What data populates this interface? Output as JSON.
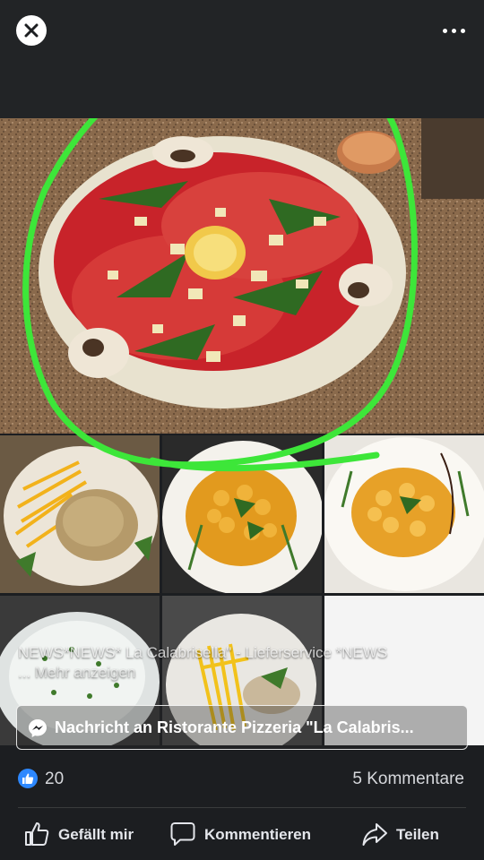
{
  "post": {
    "caption_text": "NEWS*NEWS* La Calabrisella\" - Lieferservice *NEWS",
    "caption_more": "... Mehr anzeigen"
  },
  "message_button": {
    "label": "Nachricht an Ristorante Pizzeria \"La Calabris...",
    "icon": "messenger-icon"
  },
  "reactions": {
    "like_count": "20",
    "comments": "5 Kommentare"
  },
  "actions": {
    "like": "Gefällt mir",
    "comment": "Kommentieren",
    "share": "Teilen"
  },
  "colors": {
    "background": "#1c1e21",
    "highlight": "#3de639",
    "like_blue": "#2d88ff"
  }
}
